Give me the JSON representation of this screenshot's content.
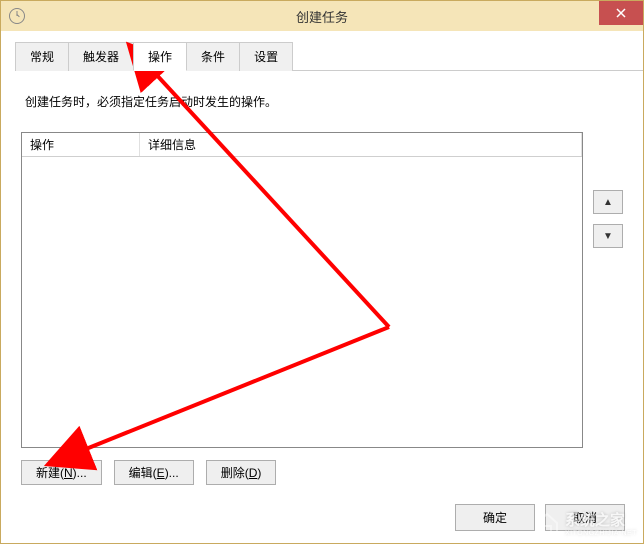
{
  "window": {
    "title": "创建任务"
  },
  "tabs": {
    "items": [
      {
        "label": "常规"
      },
      {
        "label": "触发器"
      },
      {
        "label": "操作"
      },
      {
        "label": "条件"
      },
      {
        "label": "设置"
      }
    ],
    "activeIndex": 2
  },
  "body": {
    "instruction": "创建任务时，必须指定任务启动时发生的操作。",
    "columns": {
      "action": "操作",
      "details": "详细信息"
    }
  },
  "buttons": {
    "new": "新建(N)...",
    "edit": "编辑(E)...",
    "delete": "删除(D)",
    "ok": "确定",
    "cancel": "取消",
    "up": "▲",
    "down": "▼"
  },
  "watermark": {
    "text": "系统之家",
    "subtext": "XITONGZHIJIA.NET"
  },
  "annotations": {
    "arrow1_target": "tab-actions",
    "arrow2_target": "new-button",
    "color": "#ff0000"
  }
}
